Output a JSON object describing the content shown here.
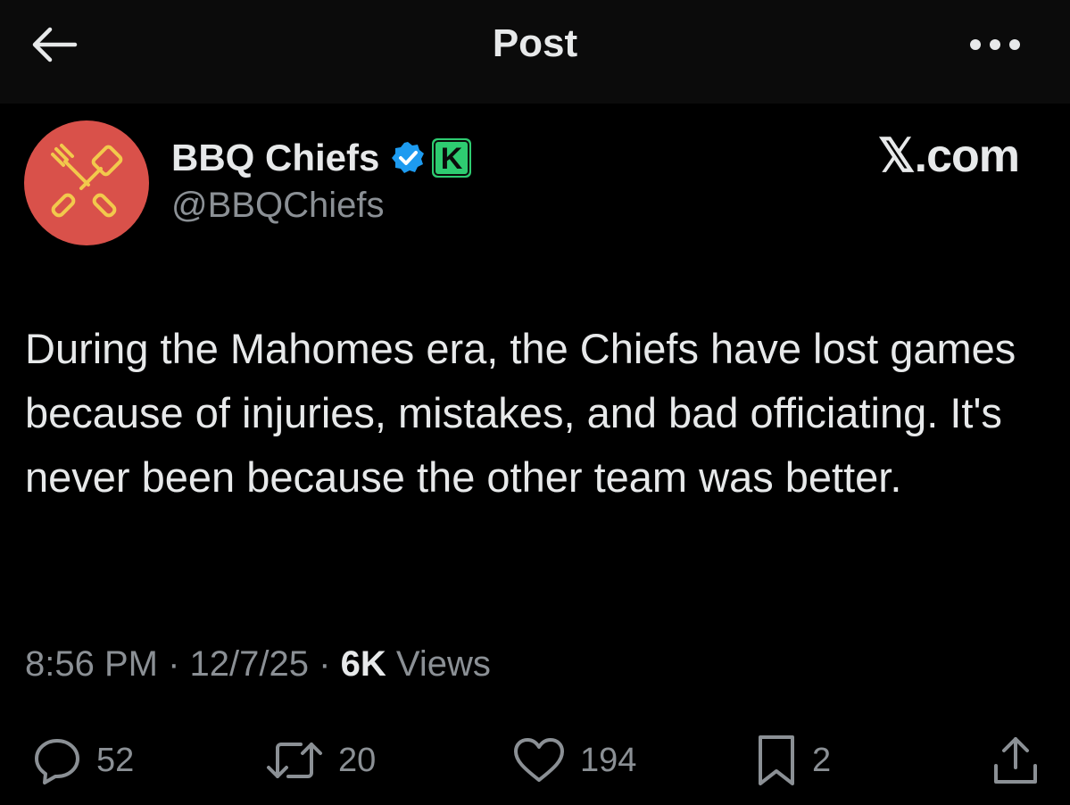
{
  "header": {
    "title": "Post",
    "back_icon": "arrow-left-icon",
    "more_icon": "more-horizontal-icon"
  },
  "author": {
    "display_name": "BBQ Chiefs",
    "handle": "@BBQChiefs",
    "verified_icon": "verified-badge-icon",
    "affiliate_badge_letter": "K",
    "avatar_icon": "crossed-bbq-tools-icon",
    "avatar_color": "#d9514a",
    "verified_color": "#1d9bf0",
    "affiliate_color": "#2ecc71"
  },
  "watermark": "𝕏.com",
  "post": {
    "text": "During the Mahomes era, the Chiefs have lost games because of injuries, mistakes, and bad officiating. It's never been because the other team was better."
  },
  "meta": {
    "time": "8:56 PM",
    "separator": "·",
    "date": "12/7/25",
    "views_count": "6K",
    "views_label": "Views"
  },
  "actions": {
    "replies": "52",
    "reposts": "20",
    "likes": "194",
    "bookmarks": "2"
  }
}
